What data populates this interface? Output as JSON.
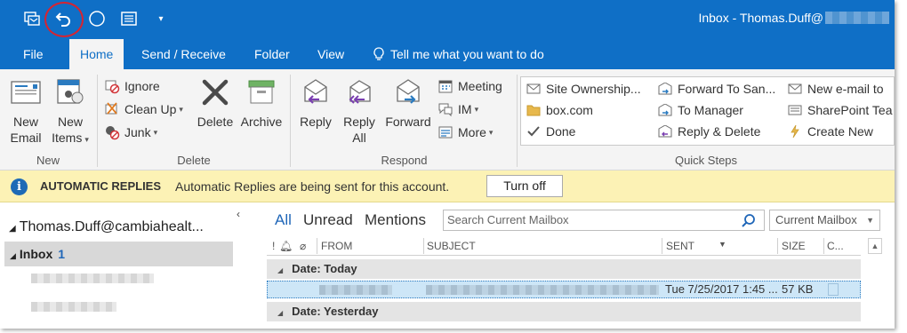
{
  "window": {
    "title": "Inbox - Thomas.Duff@"
  },
  "tabs": [
    "File",
    "Home",
    "Send / Receive",
    "Folder",
    "View"
  ],
  "tell_me": "Tell me what you want to do",
  "ribbon": {
    "new_email": [
      "New",
      "Email"
    ],
    "new_items": [
      "New",
      "Items"
    ],
    "ignore": "Ignore",
    "clean_up": "Clean Up",
    "junk": "Junk",
    "delete": "Delete",
    "archive": "Archive",
    "reply": "Reply",
    "reply_all": [
      "Reply",
      "All"
    ],
    "forward": "Forward",
    "meeting": "Meeting",
    "im": "IM",
    "more": "More",
    "groups": {
      "new": "New",
      "delete": "Delete",
      "respond": "Respond",
      "quick_steps": "Quick Steps"
    },
    "quick_steps": [
      "Site Ownership...",
      "Forward To San...",
      "New e-mail to",
      "box.com",
      "To Manager",
      "SharePoint Tea",
      "Done",
      "Reply & Delete",
      "Create New"
    ]
  },
  "infobar": {
    "title": "AUTOMATIC REPLIES",
    "message": "Automatic Replies are being sent for this account.",
    "button": "Turn off"
  },
  "folders": {
    "account": "Thomas.Duff@cambiahealt...",
    "inbox_label": "Inbox",
    "inbox_count": "1"
  },
  "mail": {
    "filters": [
      "All",
      "Unread",
      "Mentions"
    ],
    "search_placeholder": "Search Current Mailbox",
    "scope": "Current Mailbox",
    "columns": {
      "from": "FROM",
      "subject": "SUBJECT",
      "sent": "SENT",
      "size": "SIZE",
      "categories": "C..."
    },
    "groups": [
      "Date: Today",
      "Date: Yesterday"
    ],
    "rows": [
      {
        "sent": "Tue 7/25/2017 1:45 ...",
        "size": "57 KB"
      }
    ]
  },
  "colors": {
    "brand": "#0f6fc6",
    "infobar": "#fcf2b5",
    "selected_row": "#cde6f7",
    "annotation": "#d9232f"
  }
}
